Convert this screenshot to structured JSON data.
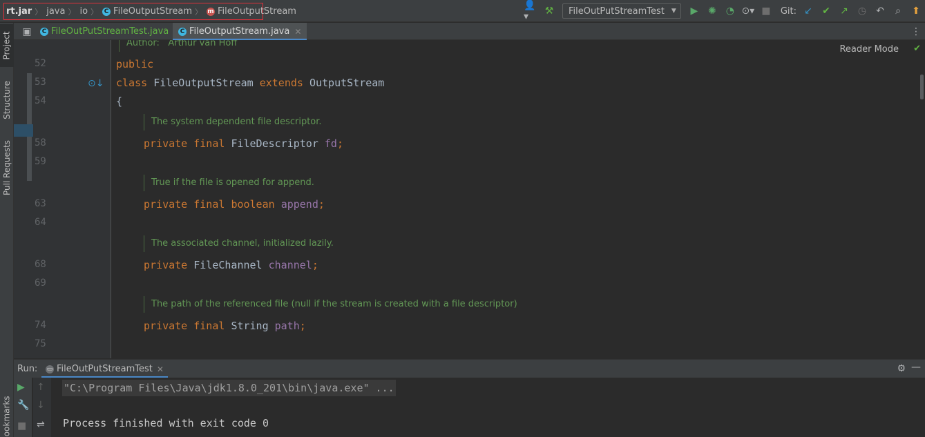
{
  "breadcrumb": {
    "root": "rt.jar",
    "pkg1": "java",
    "pkg2": "io",
    "class1": "FileOutputStream",
    "class2": "FileOutputStream"
  },
  "toolbar": {
    "run_config": "FileOutPutStreamTest",
    "git_label": "Git:"
  },
  "left_tools": {
    "project": "Project",
    "structure": "Structure",
    "pull_requests": "Pull Requests",
    "bookmarks": "Bookmarks"
  },
  "tabs": [
    {
      "label": "FileOutPutStreamTest.java"
    },
    {
      "label": "FileOutputStream.java"
    }
  ],
  "editor": {
    "author_label": "Author:",
    "author_name": "Arthur van Hoff",
    "reader_mode": "Reader Mode",
    "lines": [
      {
        "num": "52",
        "kw": "public",
        "rest": ""
      },
      {
        "num": "53",
        "kw": "class",
        "name": "FileOutputStream",
        "kw2": "extends",
        "name2": "OutputStream"
      },
      {
        "num": "54",
        "text": "{"
      },
      {
        "num": "58",
        "kw": "private final",
        "type": "FileDescriptor",
        "field": "fd",
        "punct": ";"
      },
      {
        "num": "59"
      },
      {
        "num": "63",
        "kw": "private final",
        "type": "boolean",
        "field": "append",
        "punct": ";"
      },
      {
        "num": "64"
      },
      {
        "num": "68",
        "kw": "private",
        "type": "FileChannel",
        "field": "channel",
        "punct": ";"
      },
      {
        "num": "69"
      },
      {
        "num": "74",
        "kw": "private final",
        "type": "String",
        "field": "path",
        "punct": ";"
      },
      {
        "num": "75"
      }
    ],
    "docs": [
      "The system dependent file descriptor.",
      "True if the file is opened for append.",
      "The associated channel, initialized lazily.",
      "The path of the referenced file (null if the stream is created with a file descriptor)"
    ]
  },
  "run": {
    "label": "Run:",
    "tab": "FileOutPutStreamTest",
    "command": "\"C:\\Program Files\\Java\\jdk1.8.0_201\\bin\\java.exe\" ...",
    "exit": "Process finished with exit code 0"
  }
}
